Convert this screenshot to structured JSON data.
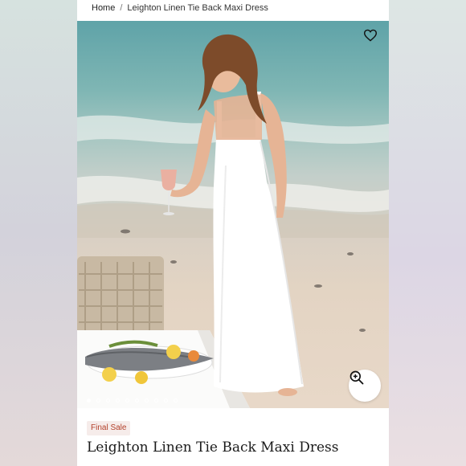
{
  "breadcrumb": {
    "home_label": "Home",
    "separator": "/",
    "current_label": "Leighton Linen Tie Back Maxi Dress"
  },
  "gallery": {
    "image_count": 10,
    "active_index": 0,
    "wishlist_icon": "heart-outline-icon",
    "zoom_icon": "zoom-in-icon"
  },
  "product": {
    "badge": "Final Sale",
    "title": "Leighton Linen Tie Back Maxi Dress",
    "badge_color": "#b3412b",
    "badge_bg": "#f6ecea"
  }
}
